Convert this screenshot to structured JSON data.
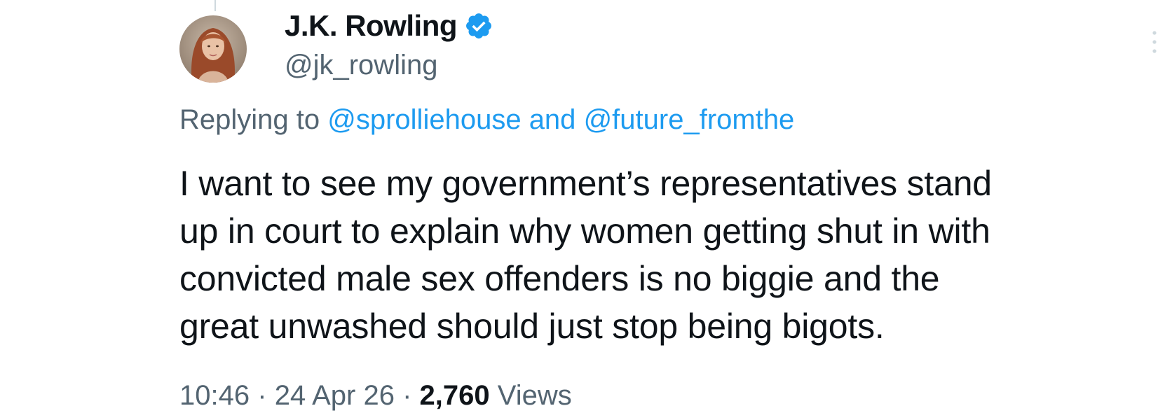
{
  "author": {
    "display_name": "J.K. Rowling",
    "handle": "@jk_rowling",
    "verified": true,
    "verified_color": "#1d9bf0"
  },
  "reply": {
    "prefix": "Replying to",
    "mention_1": "@sprolliehouse",
    "joiner": "and",
    "mention_2": "@future_fromthe"
  },
  "tweet": {
    "lines": [
      "I want to see my government’s representatives stand",
      "up in court to explain why women getting shut in with",
      "convicted male sex offenders is no biggie and the",
      "great unwashed should just stop being bigots."
    ]
  },
  "meta": {
    "time": "10:46",
    "separator": "·",
    "date": "24 Apr 26",
    "views_count": "2,760",
    "views_label": "Views"
  },
  "icons": {
    "verified": "verified-badge-icon",
    "more": "more-options-icon"
  },
  "colors": {
    "text_primary": "#0f1419",
    "text_secondary": "#536471",
    "link": "#1d9bf0"
  }
}
